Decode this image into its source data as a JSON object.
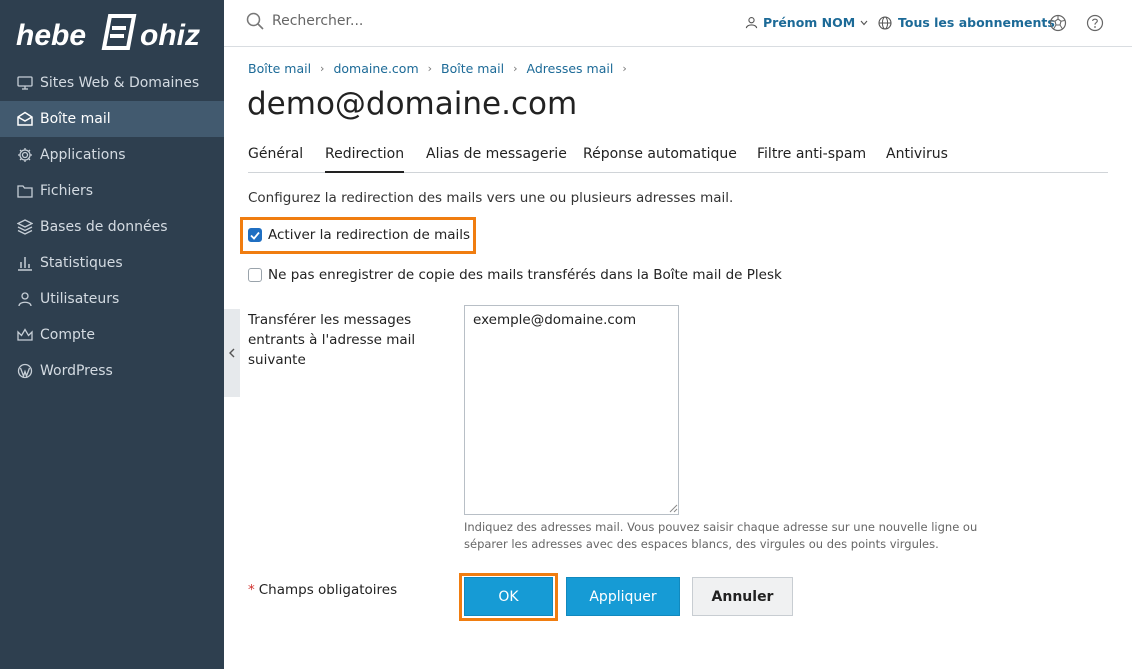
{
  "brand": {
    "logo_text": "hebergeur Ohiz"
  },
  "sidebar": {
    "items": [
      {
        "label": "Sites Web & Domaines",
        "icon": "monitor-icon"
      },
      {
        "label": "Boîte mail",
        "icon": "mail-icon",
        "active": true
      },
      {
        "label": "Applications",
        "icon": "gear-icon"
      },
      {
        "label": "Fichiers",
        "icon": "folder-icon"
      },
      {
        "label": "Bases de données",
        "icon": "layers-icon"
      },
      {
        "label": "Statistiques",
        "icon": "bar-chart-icon"
      },
      {
        "label": "Utilisateurs",
        "icon": "user-icon"
      },
      {
        "label": "Compte",
        "icon": "crown-icon"
      },
      {
        "label": "WordPress",
        "icon": "wordpress-icon"
      }
    ]
  },
  "topbar": {
    "search_placeholder": "Rechercher...",
    "user_name": "Prénom NOM",
    "subscriptions": "Tous les abonnements"
  },
  "breadcrumb": [
    "Boîte mail",
    "domaine.com",
    "Boîte mail",
    "Adresses mail"
  ],
  "page_title": "demo@domaine.com",
  "tabs": [
    {
      "label": "Général"
    },
    {
      "label": "Redirection",
      "active": true
    },
    {
      "label": "Alias de messagerie"
    },
    {
      "label": "Réponse automatique"
    },
    {
      "label": "Filtre anti-spam"
    },
    {
      "label": "Antivirus"
    }
  ],
  "form": {
    "description": "Configurez la redirection des mails vers une ou plusieurs adresses mail.",
    "enable_redirect_label": "Activer la redirection de mails",
    "enable_redirect_checked": true,
    "no_copy_label": "Ne pas enregistrer de copie des mails transférés dans la Boîte mail de Plesk",
    "no_copy_checked": false,
    "forward_label": "Transférer les messages entrants à l'adresse mail suivante",
    "forward_value": "exemple@domaine.com",
    "hint": "Indiquez des adresses mail. Vous pouvez saisir chaque adresse sur une nouvelle ligne ou séparer les adresses avec des espaces blancs, des virgules ou des points virgules.",
    "required_star": "*",
    "required_note": "Champs obligatoires"
  },
  "buttons": {
    "ok": "OK",
    "apply": "Appliquer",
    "cancel": "Annuler"
  },
  "colors": {
    "sidebar_bg": "#2e3f4f",
    "sidebar_active": "#425a6f",
    "primary": "#169bd5",
    "highlight": "#f07d10",
    "link": "#1c6a97"
  }
}
